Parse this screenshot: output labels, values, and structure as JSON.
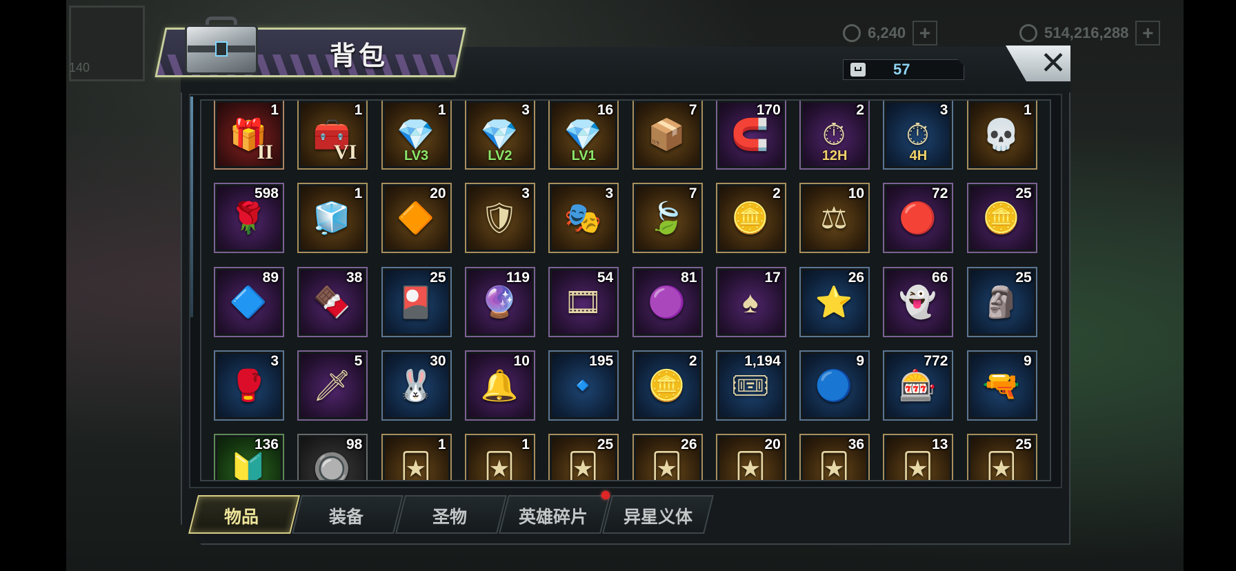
{
  "background": {
    "resources": [
      {
        "icon": "hexagon-gear-icon",
        "value": "6,240"
      },
      {
        "icon": "coin-icon",
        "value": "514,216,288"
      }
    ],
    "player_level": "140"
  },
  "window": {
    "title": "背包",
    "capacity_count": "57",
    "close_label": "✕"
  },
  "items": [
    {
      "icon": "sss-chest-icon",
      "glyph": "🎁",
      "qty": "1",
      "quality": "red",
      "roman": "II"
    },
    {
      "icon": "tier-chest-icon",
      "glyph": "🧰",
      "qty": "1",
      "quality": "gold",
      "roman": "VI"
    },
    {
      "icon": "gem-chest-lv3-icon",
      "glyph": "💎",
      "qty": "1",
      "quality": "gold",
      "tag": "LV3"
    },
    {
      "icon": "gem-chest-lv2-icon",
      "glyph": "💎",
      "qty": "3",
      "quality": "gold",
      "tag": "LV2"
    },
    {
      "icon": "gem-chest-lv1-icon",
      "glyph": "💎",
      "qty": "16",
      "quality": "gold",
      "tag": "LV1"
    },
    {
      "icon": "blue-chest-icon",
      "glyph": "📦",
      "qty": "7",
      "quality": "gold"
    },
    {
      "icon": "spinning-magnet-icon",
      "glyph": "🧲",
      "qty": "170",
      "quality": "purple"
    },
    {
      "icon": "speedup-12h-icon",
      "glyph": "⏱",
      "qty": "2",
      "quality": "purple",
      "tag": "12H"
    },
    {
      "icon": "speedup-4h-icon",
      "glyph": "⏱",
      "qty": "3",
      "quality": "blue",
      "tag": "4H"
    },
    {
      "icon": "golden-skull-icon",
      "glyph": "💀",
      "qty": "1",
      "quality": "gold"
    },
    {
      "icon": "rose-dome-icon",
      "glyph": "🌹",
      "qty": "598",
      "quality": "purple"
    },
    {
      "icon": "cube-frame-icon",
      "glyph": "🧊",
      "qty": "1",
      "quality": "gold"
    },
    {
      "icon": "gold-fragment-icon",
      "glyph": "🔶",
      "qty": "20",
      "quality": "gold"
    },
    {
      "icon": "super-badge-icon",
      "glyph": "🛡",
      "qty": "3",
      "quality": "gold"
    },
    {
      "icon": "purple-mask-badge-icon",
      "glyph": "🎭",
      "qty": "3",
      "quality": "gold"
    },
    {
      "icon": "green-leaf-badge-icon",
      "glyph": "🍃",
      "qty": "7",
      "quality": "gold"
    },
    {
      "icon": "yellow-emblem-icon",
      "glyph": "🪙",
      "qty": "2",
      "quality": "gold"
    },
    {
      "icon": "scales-badge-icon",
      "glyph": "⚖",
      "qty": "10",
      "quality": "gold"
    },
    {
      "icon": "pink-bottlecap-icon",
      "glyph": "🔴",
      "qty": "72",
      "quality": "purple"
    },
    {
      "icon": "silver-coin-icon",
      "glyph": "🪙",
      "qty": "25",
      "quality": "purple"
    },
    {
      "icon": "white-crystal-icon",
      "glyph": "🔷",
      "qty": "89",
      "quality": "purple"
    },
    {
      "icon": "chocolate-bar-icon",
      "glyph": "🍫",
      "qty": "38",
      "quality": "purple"
    },
    {
      "icon": "gold-card-icon",
      "glyph": "🎴",
      "qty": "25",
      "quality": "blue"
    },
    {
      "icon": "purple-fragment-icon",
      "glyph": "🔮",
      "qty": "119",
      "quality": "purple"
    },
    {
      "icon": "film-reel-icon",
      "glyph": "🎞",
      "qty": "54",
      "quality": "purple"
    },
    {
      "icon": "purple-bottlecap-icon",
      "glyph": "🟣",
      "qty": "81",
      "quality": "purple"
    },
    {
      "icon": "poker-chip-badge-icon",
      "glyph": "♠",
      "qty": "17",
      "quality": "purple"
    },
    {
      "icon": "police-badge-icon",
      "glyph": "⭐",
      "qty": "26",
      "quality": "blue"
    },
    {
      "icon": "silver-figure-icon",
      "glyph": "👻",
      "qty": "66",
      "quality": "purple"
    },
    {
      "icon": "green-flame-statue-icon",
      "glyph": "🗿",
      "qty": "25",
      "quality": "blue"
    },
    {
      "icon": "boxing-glove-icon",
      "glyph": "🥊",
      "qty": "3",
      "quality": "blue"
    },
    {
      "icon": "laser-sword-icon",
      "glyph": "🗡",
      "qty": "5",
      "quality": "purple"
    },
    {
      "icon": "bunny-badge-icon",
      "glyph": "🐰",
      "qty": "30",
      "quality": "blue"
    },
    {
      "icon": "christmas-bell-icon",
      "glyph": "🔔",
      "qty": "10",
      "quality": "purple"
    },
    {
      "icon": "blue-fragment-icon",
      "glyph": "🔹",
      "qty": "195",
      "quality": "blue"
    },
    {
      "icon": "gold-mask-coin-icon",
      "glyph": "🪙",
      "qty": "2",
      "quality": "blue"
    },
    {
      "icon": "cinema-ticket-icon",
      "glyph": "🎟",
      "qty": "1,194",
      "quality": "blue"
    },
    {
      "icon": "blue-bottlecap-icon",
      "glyph": "🔵",
      "qty": "9",
      "quality": "blue"
    },
    {
      "icon": "red-poker-chip-icon",
      "glyph": "🎰",
      "qty": "772",
      "quality": "blue"
    },
    {
      "icon": "bullet-icon",
      "glyph": "🔫",
      "qty": "9",
      "quality": "blue"
    },
    {
      "icon": "green-fragment-icon",
      "glyph": "🔰",
      "qty": "136",
      "quality": "green"
    },
    {
      "icon": "grey-fragment-icon",
      "glyph": "🔘",
      "qty": "98",
      "quality": "grey"
    },
    {
      "icon": "gold-hero-card-icon",
      "glyph": "🃏",
      "qty": "1",
      "quality": "gold"
    },
    {
      "icon": "gold-hero-card-icon",
      "glyph": "🃏",
      "qty": "1",
      "quality": "gold"
    },
    {
      "icon": "gold-hero-card-icon",
      "glyph": "🃏",
      "qty": "25",
      "quality": "gold"
    },
    {
      "icon": "gold-hero-card-icon",
      "glyph": "🃏",
      "qty": "26",
      "quality": "gold"
    },
    {
      "icon": "gold-hero-card-icon",
      "glyph": "🃏",
      "qty": "20",
      "quality": "gold"
    },
    {
      "icon": "gold-hero-card-icon",
      "glyph": "🃏",
      "qty": "36",
      "quality": "gold"
    },
    {
      "icon": "gold-hero-card-icon",
      "glyph": "🃏",
      "qty": "13",
      "quality": "gold"
    },
    {
      "icon": "gold-hero-card-icon",
      "glyph": "🃏",
      "qty": "25",
      "quality": "gold"
    }
  ],
  "tabs": [
    {
      "label": "物品",
      "active": true
    },
    {
      "label": "装备",
      "active": false
    },
    {
      "label": "圣物",
      "active": false
    },
    {
      "label": "英雄碎片",
      "active": false,
      "notification": true
    },
    {
      "label": "异星义体",
      "active": false
    }
  ],
  "colors": {
    "accent": "#d8cf86",
    "counter_text": "#8fd3f2",
    "notification": "#e02525"
  }
}
